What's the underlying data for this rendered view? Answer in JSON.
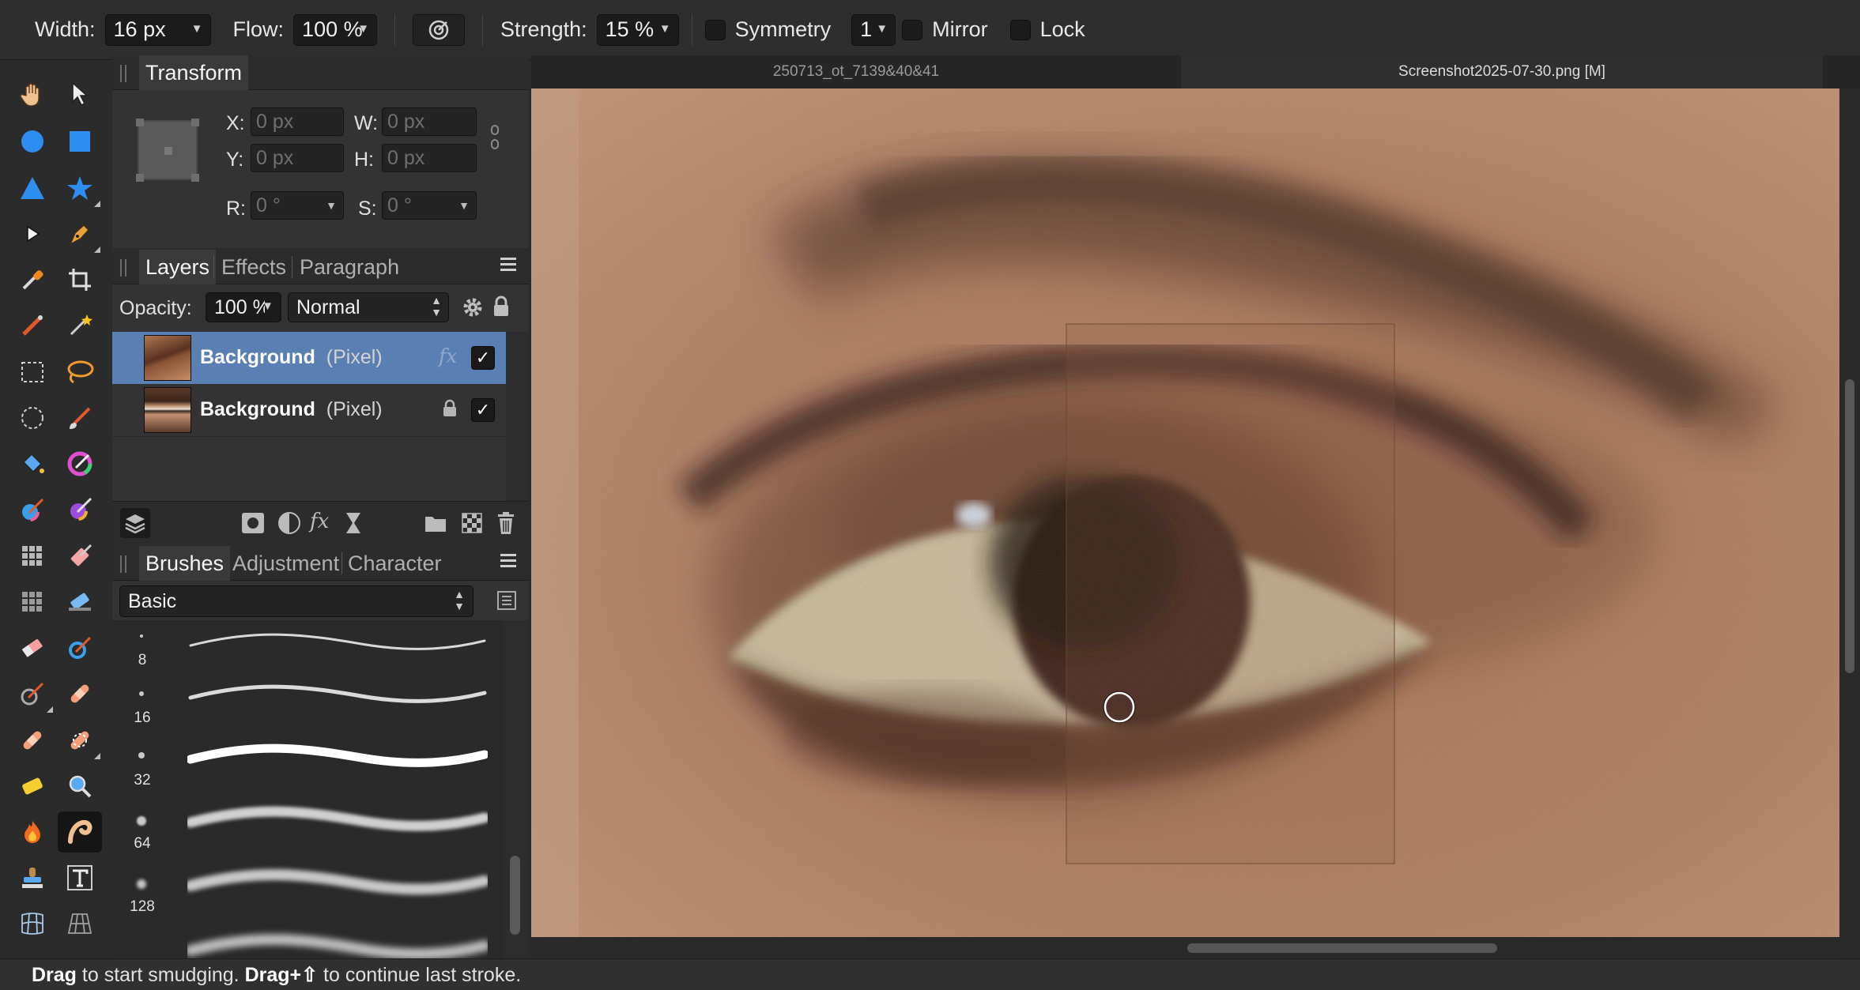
{
  "context_toolbar": {
    "width_label": "Width:",
    "width_value": "16 px",
    "flow_label": "Flow:",
    "flow_value": "100 %",
    "strength_label": "Strength:",
    "strength_value": "15 %",
    "symmetry_label": "Symmetry",
    "symmetry_count": "1",
    "mirror_label": "Mirror",
    "lock_label": "Lock"
  },
  "transform_panel": {
    "title": "Transform",
    "x_label": "X:",
    "x_placeholder": "0 px",
    "y_label": "Y:",
    "y_placeholder": "0 px",
    "w_label": "W:",
    "w_placeholder": "0 px",
    "h_label": "H:",
    "h_placeholder": "0 px",
    "r_label": "R:",
    "r_placeholder": "0 °",
    "s_label": "S:",
    "s_placeholder": "0 °"
  },
  "layers_panel": {
    "tabs": [
      "Layers",
      "Effects",
      "Paragraph"
    ],
    "opacity_label": "Opacity:",
    "opacity_value": "100 %",
    "blend_mode": "Normal",
    "layers": [
      {
        "name": "Background",
        "type": "(Pixel)",
        "selected": true,
        "fx": "fx",
        "visible": true
      },
      {
        "name": "Background",
        "type": "(Pixel)",
        "selected": false,
        "locked": true,
        "visible": true
      }
    ]
  },
  "brushes_panel": {
    "tabs": [
      "Brushes",
      "Adjustment",
      "Character"
    ],
    "category": "Basic",
    "sizes": [
      "8",
      "16",
      "32",
      "64",
      "128"
    ]
  },
  "document_tabs": [
    {
      "label": "250713_ot_7139&40&41",
      "active": false
    },
    {
      "label": "Screenshot2025-07-30.png [M]",
      "active": true
    }
  ],
  "status_bar": {
    "part1_bold": "Drag",
    "part2": " to start smudging. ",
    "part3_bold": "Drag+⇧",
    "part4": " to continue last stroke."
  },
  "icons": {
    "check_glyph": "✓"
  }
}
